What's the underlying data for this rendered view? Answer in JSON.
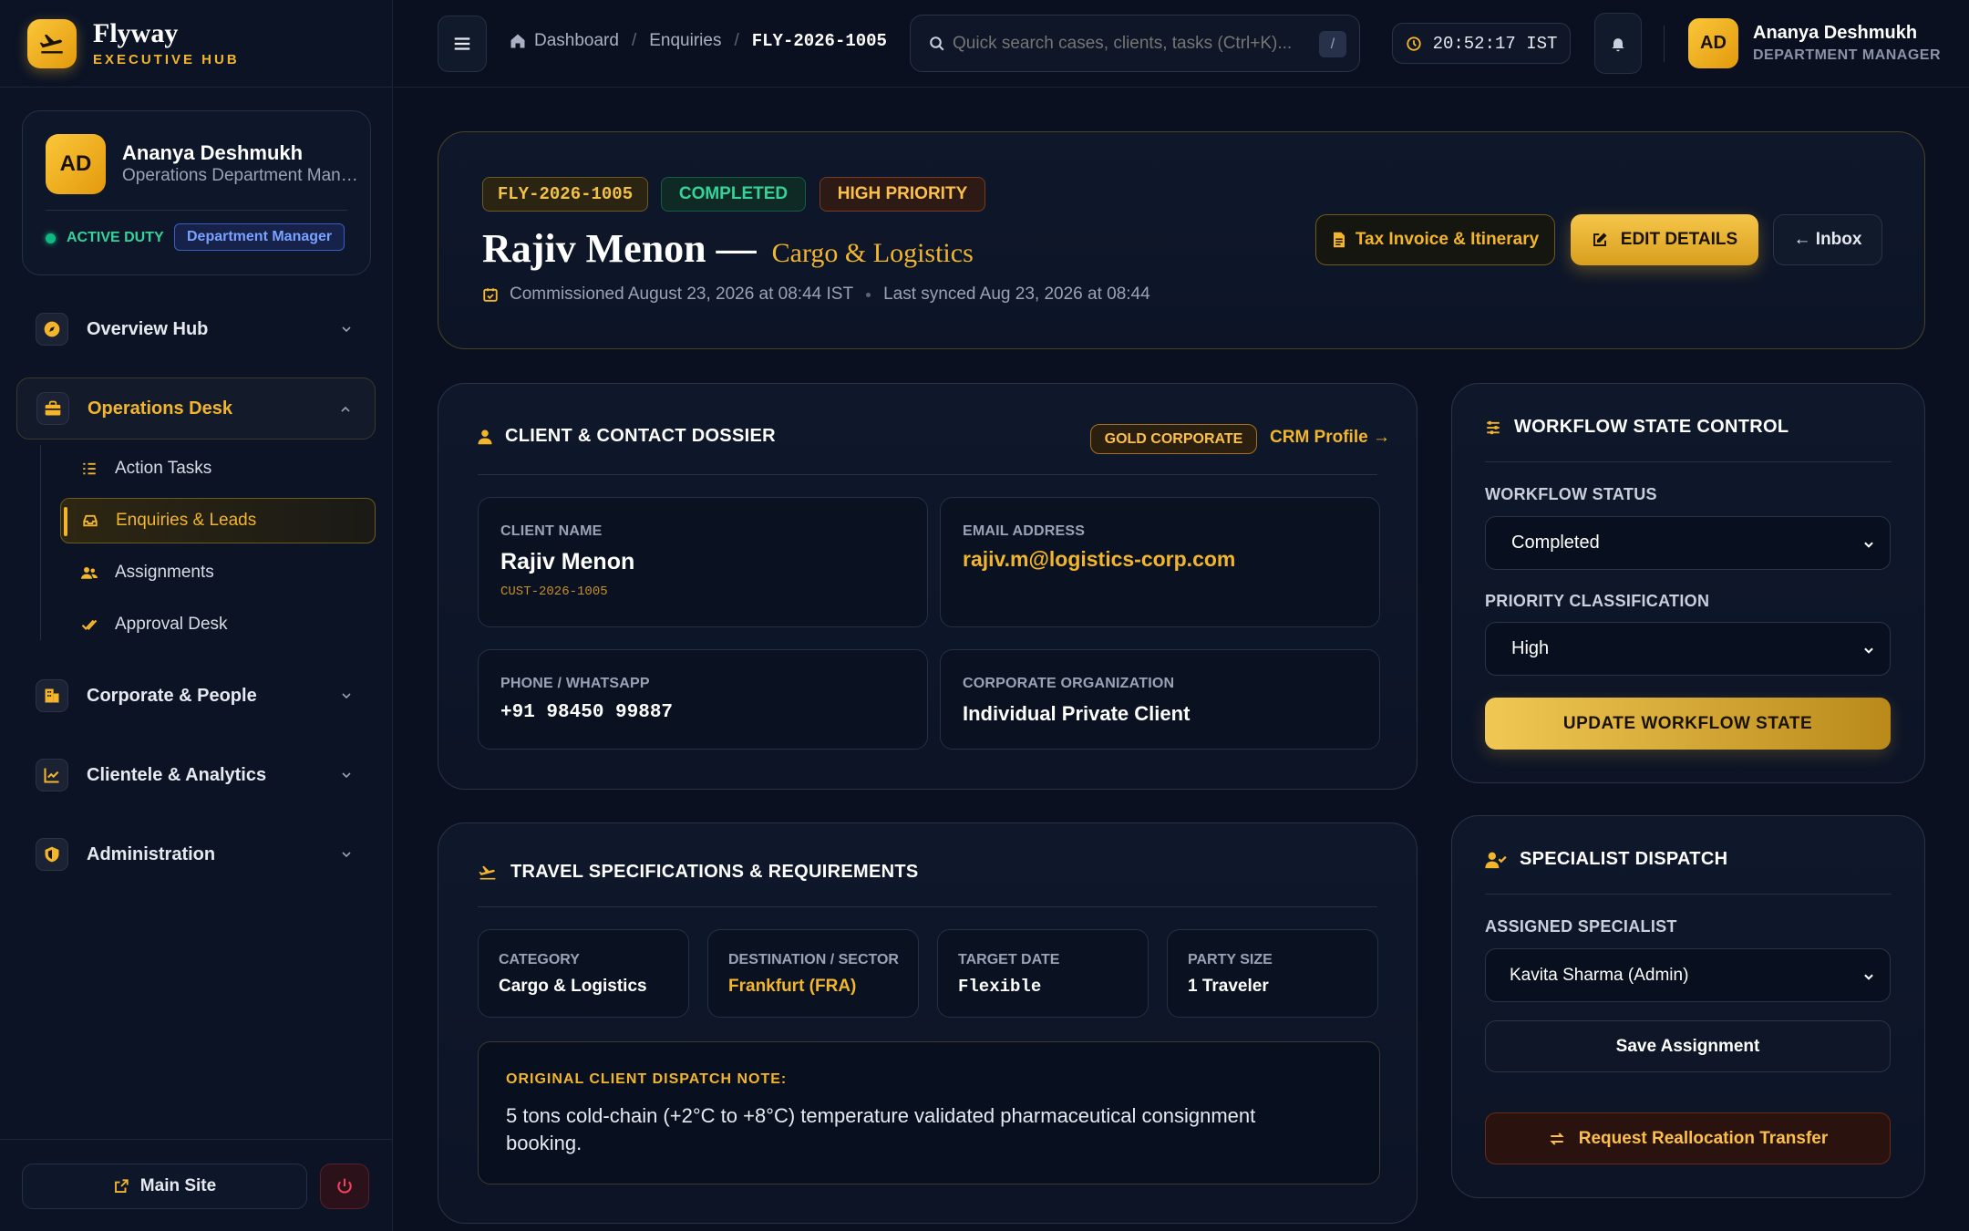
{
  "brand": {
    "name": "Flyway",
    "sub": "EXECUTIVE HUB"
  },
  "profile": {
    "initials": "AD",
    "name": "Ananya Deshmukh",
    "role": "Operations Department Manager",
    "duty": "ACTIVE DUTY",
    "badge": "Department Manager"
  },
  "nav": {
    "overview": "Overview Hub",
    "operations": "Operations Desk",
    "sub": {
      "tasks": "Action Tasks",
      "enquiries": "Enquiries & Leads",
      "assignments": "Assignments",
      "approval": "Approval Desk"
    },
    "corporate": "Corporate & People",
    "clientele": "Clientele & Analytics",
    "admin": "Administration"
  },
  "footer": {
    "main_site": "Main Site"
  },
  "header": {
    "crumbs": [
      "Dashboard",
      "Enquiries",
      "FLY-2026-1005"
    ],
    "search_placeholder": "Quick search cases, clients, tasks (Ctrl+K)...",
    "search_kbd": "/",
    "clock": "20:52:17 IST",
    "user": {
      "initials": "AD",
      "name": "Ananya Deshmukh",
      "role": "DEPARTMENT MANAGER"
    }
  },
  "hero": {
    "id": "FLY-2026-1005",
    "status": "COMPLETED",
    "priority": "HIGH PRIORITY",
    "client": "Rajiv Menon —",
    "category": "Cargo & Logistics",
    "commissioned": "Commissioned August 23, 2026 at 08:44 IST",
    "synced": "Last synced Aug 23, 2026 at 08:44",
    "btn_invoice": "Tax Invoice & Itinerary",
    "btn_edit": "EDIT DETAILS",
    "btn_inbox": "← Inbox"
  },
  "dossier": {
    "title": "CLIENT & CONTACT DOSSIER",
    "tier": "GOLD CORPORATE",
    "crm": "CRM Profile →",
    "client_label": "CLIENT NAME",
    "client_name": "Rajiv Menon",
    "client_id": "CUST-2026-1005",
    "email_label": "EMAIL ADDRESS",
    "email": "rajiv.m@logistics-corp.com",
    "phone_label": "PHONE / WHATSAPP",
    "phone": "+91 98450 99887",
    "org_label": "CORPORATE ORGANIZATION",
    "org": "Individual Private Client"
  },
  "travel": {
    "title": "TRAVEL SPECIFICATIONS & REQUIREMENTS",
    "category_label": "CATEGORY",
    "category": "Cargo & Logistics",
    "dest_label": "DESTINATION / SECTOR",
    "dest": "Frankfurt (FRA)",
    "date_label": "TARGET DATE",
    "date": "Flexible",
    "party_label": "PARTY SIZE",
    "party": "1 Traveler",
    "note_label": "ORIGINAL CLIENT DISPATCH NOTE:",
    "note": "5 tons cold-chain (+2°C to +8°C) temperature validated pharmaceutical consignment booking."
  },
  "workflow": {
    "title": "WORKFLOW STATE CONTROL",
    "status_label": "WORKFLOW STATUS",
    "status": "Completed",
    "priority_label": "PRIORITY CLASSIFICATION",
    "priority": "High",
    "btn": "UPDATE WORKFLOW STATE"
  },
  "dispatch": {
    "title": "SPECIALIST DISPATCH",
    "label": "ASSIGNED SPECIALIST",
    "specialist": "Kavita Sharma (Admin)",
    "save": "Save Assignment",
    "realloc": "Request Reallocation Transfer"
  },
  "colors": {
    "accent": "#f2b52c",
    "success": "#34d399",
    "bg": "#0a1020"
  }
}
